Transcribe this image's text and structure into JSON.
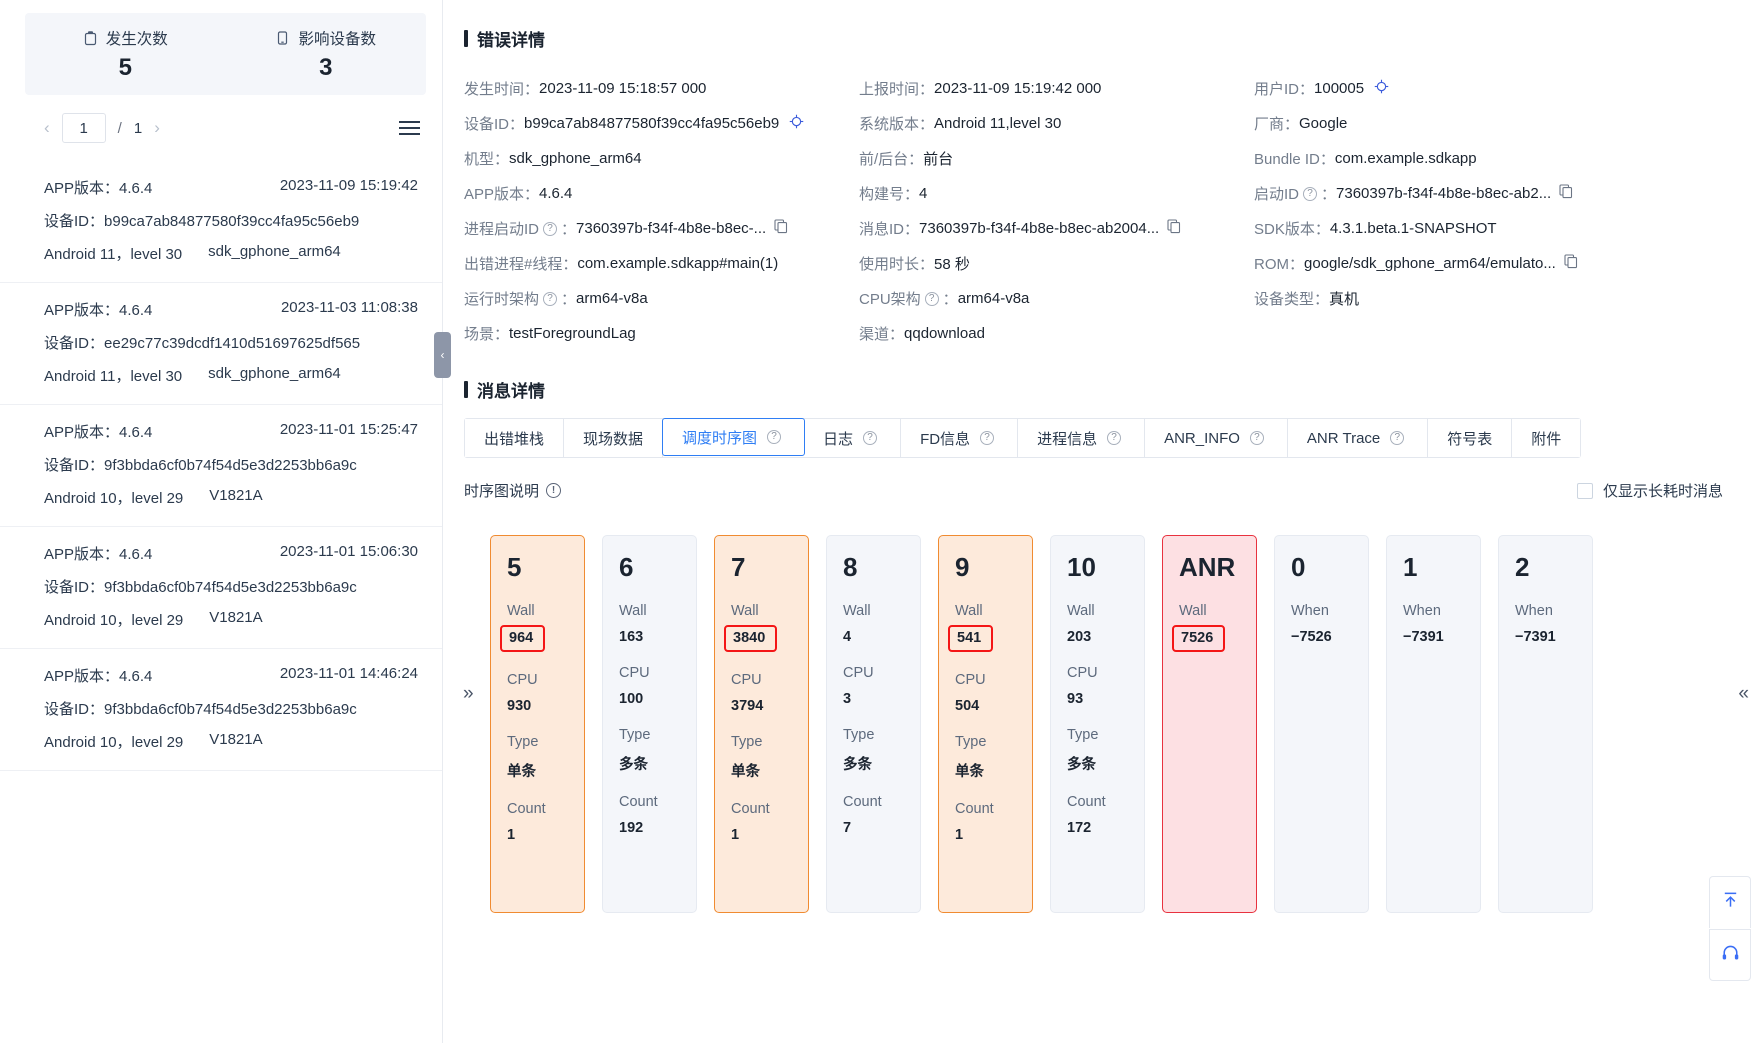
{
  "stats": {
    "occurrences": {
      "icon": "clipboard-icon",
      "label": "发生次数",
      "value": "5"
    },
    "devices": {
      "icon": "mobile-icon",
      "label": "影响设备数",
      "value": "3"
    }
  },
  "pagination": {
    "prev": "‹",
    "current": "1",
    "separator": "/",
    "total": "1",
    "next": "›"
  },
  "crash_list": [
    {
      "version_label": "APP版本：",
      "version": "4.6.4",
      "time": "2023-11-09 15:19:42",
      "device_label": "设备ID：",
      "device_id": "b99ca7ab84877580f39cc4fa95c56eb9",
      "os": "Android 11，level 30",
      "model": "sdk_gphone_arm64"
    },
    {
      "version_label": "APP版本：",
      "version": "4.6.4",
      "time": "2023-11-03 11:08:38",
      "device_label": "设备ID：",
      "device_id": "ee29c77c39dcdf1410d51697625df565",
      "os": "Android 11，level 30",
      "model": "sdk_gphone_arm64"
    },
    {
      "version_label": "APP版本：",
      "version": "4.6.4",
      "time": "2023-11-01 15:25:47",
      "device_label": "设备ID：",
      "device_id": "9f3bbda6cf0b74f54d5e3d2253bb6a9c",
      "os": "Android 10，level 29",
      "model": "V1821A"
    },
    {
      "version_label": "APP版本：",
      "version": "4.6.4",
      "time": "2023-11-01 15:06:30",
      "device_label": "设备ID：",
      "device_id": "9f3bbda6cf0b74f54d5e3d2253bb6a9c",
      "os": "Android 10，level 29",
      "model": "V1821A"
    },
    {
      "version_label": "APP版本：",
      "version": "4.6.4",
      "time": "2023-11-01 14:46:24",
      "device_label": "设备ID：",
      "device_id": "9f3bbda6cf0b74f54d5e3d2253bb6a9c",
      "os": "Android 10，level 29",
      "model": "V1821A"
    }
  ],
  "error_detail": {
    "title": "错误详情",
    "rows": {
      "occur_time_label": "发生时间：",
      "occur_time": "2023-11-09 15:18:57 000",
      "report_time_label": "上报时间：",
      "report_time": "2023-11-09 15:19:42 000",
      "user_id_label": "用户ID：",
      "user_id": "100005",
      "device_id_label": "设备ID：",
      "device_id": "b99ca7ab84877580f39cc4fa95c56eb9",
      "os_version_label": "系统版本：",
      "os_version": "Android 11,level 30",
      "vendor_label": "厂商：",
      "vendor": "Google",
      "model_label": "机型：",
      "model": "sdk_gphone_arm64",
      "fg_bg_label": "前/后台：",
      "fg_bg": "前台",
      "bundle_id_label": "Bundle ID：",
      "bundle_id": "com.example.sdkapp",
      "app_version_label": "APP版本：",
      "app_version": "4.6.4",
      "build_no_label": "构建号：",
      "build_no": "4",
      "launch_id_label": "启动ID",
      "launch_id": "7360397b-f34f-4b8e-b8ec-ab2...",
      "process_launch_id_label": "进程启动ID",
      "process_launch_id": "7360397b-f34f-4b8e-b8ec-...",
      "message_id_label": "消息ID：",
      "message_id": "7360397b-f34f-4b8e-b8ec-ab2004...",
      "sdk_version_label": "SDK版本：",
      "sdk_version": "4.3.1.beta.1-SNAPSHOT",
      "error_process_label": "出错进程#线程：",
      "error_process": "com.example.sdkapp#main(1)",
      "duration_label": "使用时长：",
      "duration": "58 秒",
      "rom_label": "ROM：",
      "rom": "google/sdk_gphone_arm64/emulato...",
      "runtime_arch_label": "运行时架构",
      "runtime_arch": "arm64-v8a",
      "cpu_arch_label": "CPU架构",
      "cpu_arch": "arm64-v8a",
      "device_type_label": "设备类型：",
      "device_type": "真机",
      "scene_label": "场景：",
      "scene": "testForegroundLag",
      "channel_label": "渠道：",
      "channel": "qqdownload"
    }
  },
  "message_detail": {
    "title": "消息详情",
    "tabs": [
      {
        "label": "出错堆栈",
        "help": false,
        "active": false
      },
      {
        "label": "现场数据",
        "help": false,
        "active": false
      },
      {
        "label": "调度时序图",
        "help": true,
        "active": true
      },
      {
        "label": "日志",
        "help": true,
        "active": false
      },
      {
        "label": "FD信息",
        "help": true,
        "active": false
      },
      {
        "label": "进程信息",
        "help": true,
        "active": false
      },
      {
        "label": "ANR_INFO",
        "help": true,
        "active": false
      },
      {
        "label": "ANR Trace",
        "help": true,
        "active": false
      },
      {
        "label": "符号表",
        "help": false,
        "active": false
      },
      {
        "label": "附件",
        "help": false,
        "active": false
      }
    ],
    "legend_label": "时序图说明",
    "filter_label": "仅显示长耗时消息",
    "filter_checked": false,
    "scroll_left": "»",
    "scroll_right": "«"
  },
  "chart_data": {
    "type": "table",
    "title": "调度时序图",
    "row_labels": {
      "wall": "Wall",
      "cpu": "CPU",
      "type": "Type",
      "count": "Count",
      "when": "When"
    },
    "cards": [
      {
        "index": "5",
        "style": "warn",
        "wall": "964",
        "wall_highlight": true,
        "cpu": "930",
        "type": "单条",
        "count": "1"
      },
      {
        "index": "6",
        "style": "normal",
        "wall": "163",
        "wall_highlight": false,
        "cpu": "100",
        "type": "多条",
        "count": "192"
      },
      {
        "index": "7",
        "style": "warn",
        "wall": "3840",
        "wall_highlight": true,
        "cpu": "3794",
        "type": "单条",
        "count": "1"
      },
      {
        "index": "8",
        "style": "normal",
        "wall": "4",
        "wall_highlight": false,
        "cpu": "3",
        "type": "多条",
        "count": "7"
      },
      {
        "index": "9",
        "style": "warn",
        "wall": "541",
        "wall_highlight": true,
        "cpu": "504",
        "type": "单条",
        "count": "1"
      },
      {
        "index": "10",
        "style": "normal",
        "wall": "203",
        "wall_highlight": false,
        "cpu": "93",
        "type": "多条",
        "count": "172"
      },
      {
        "index": "ANR",
        "style": "anr",
        "wall": "7526",
        "wall_highlight": true
      },
      {
        "index": "0",
        "style": "normal",
        "when": "−7526"
      },
      {
        "index": "1",
        "style": "normal",
        "when": "−7391"
      },
      {
        "index": "2",
        "style": "normal",
        "when": "−7391"
      }
    ]
  },
  "fabs": {
    "top_icon": "scroll-to-top-icon",
    "support_icon": "headset-icon"
  }
}
